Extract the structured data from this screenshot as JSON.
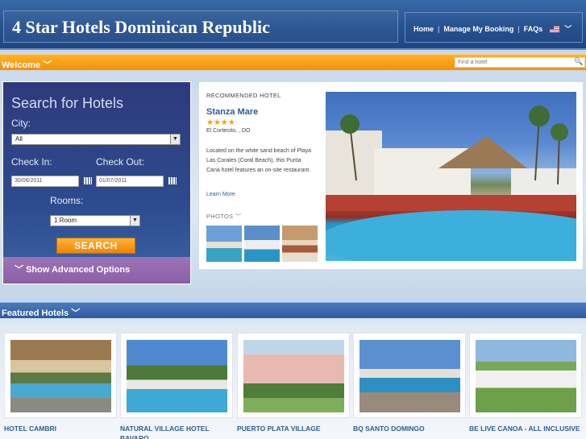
{
  "header": {
    "site_title": "4 Star Hotels Dominican Republic",
    "nav": {
      "home": "Home",
      "manage": "Manage My Booking",
      "faqs": "FAQs",
      "separator": "|"
    }
  },
  "welcome": {
    "label": "Welcome",
    "find_placeholder": "Find a hotel"
  },
  "search": {
    "title": "Search for Hotels",
    "city_label": "City:",
    "city_value": "All",
    "checkin_label": "Check In:",
    "checkout_label": "Check Out:",
    "checkin_value": "30/06/2011",
    "checkout_value": "01/07/2011",
    "rooms_label": "Rooms:",
    "rooms_value": "1 Room",
    "search_button": "SEARCH",
    "advanced": "Show Advanced Options"
  },
  "recommended": {
    "heading": "RECOMMENDED HOTEL",
    "name": "Stanza Mare",
    "stars": "★★★★",
    "location": "El Cortecito, , DO",
    "description": "Located on the white sand beach of Playa Las Corales (Coral Beach), this Punta Cana hotel features an on-site restaurant.",
    "learn_more": "Learn More",
    "photos_label": "PHOTOS"
  },
  "featured": {
    "label": "Featured Hotels",
    "hotels": [
      {
        "name": "HOTEL CAMBRI"
      },
      {
        "name": "NATURAL VILLAGE HOTEL BAVARO"
      },
      {
        "name": "PUERTO PLATA VILLAGE"
      },
      {
        "name": "BQ SANTO DOMINGO"
      },
      {
        "name": "BE LIVE CANOA - ALL INCLUSIVE"
      }
    ]
  },
  "colors": {
    "header_blue": "#26508e",
    "accent_orange": "#f39200",
    "link_blue": "#2a5d9c",
    "purple": "#8a5fa6"
  }
}
